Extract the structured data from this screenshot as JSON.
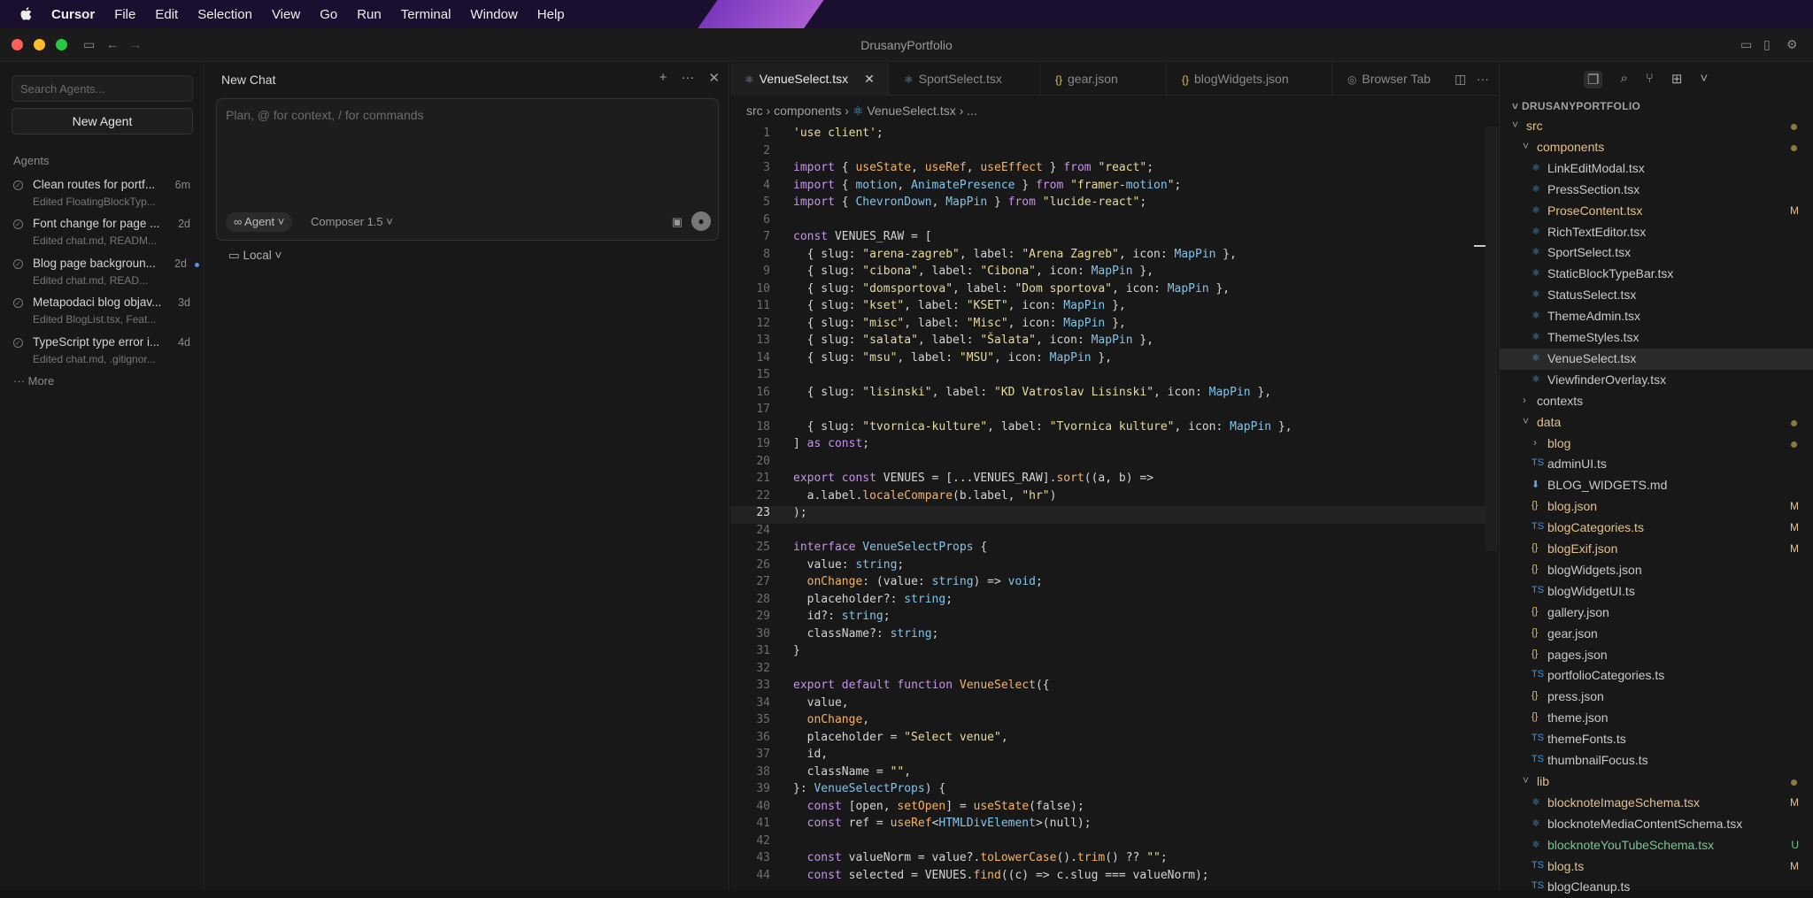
{
  "menubar": {
    "app": "Cursor",
    "items": [
      "File",
      "Edit",
      "Selection",
      "View",
      "Go",
      "Run",
      "Terminal",
      "Window",
      "Help"
    ]
  },
  "window": {
    "title": "DrusanyPortfolio"
  },
  "agents_panel": {
    "search_placeholder": "Search Agents...",
    "new_agent": "New Agent",
    "heading": "Agents",
    "items": [
      {
        "title": "Clean routes for portf...",
        "sub": "Edited FloatingBlockTyp...",
        "time": "6m",
        "unread": false
      },
      {
        "title": "Font change for page ...",
        "sub": "Edited chat.md, READM...",
        "time": "2d",
        "unread": false
      },
      {
        "title": "Blog page backgroun...",
        "sub": "Edited chat.md, READ...",
        "time": "2d",
        "unread": true
      },
      {
        "title": "Metapodaci blog objav...",
        "sub": "Edited BlogList.tsx, Feat...",
        "time": "3d",
        "unread": false
      },
      {
        "title": "TypeScript type error i...",
        "sub": "Edited chat.md, .gitignor...",
        "time": "4d",
        "unread": false
      }
    ],
    "more": "More"
  },
  "chat": {
    "title": "New Chat",
    "placeholder": "Plan, @ for context, / for commands",
    "mode": "Agent",
    "model": "Composer 1.5",
    "location": "Local"
  },
  "editor": {
    "tabs": [
      {
        "label": "VenueSelect.tsx",
        "icon": "react",
        "active": true
      },
      {
        "label": "SportSelect.tsx",
        "icon": "react",
        "active": false
      },
      {
        "label": "gear.json",
        "icon": "json",
        "active": false
      },
      {
        "label": "blogWidgets.json",
        "icon": "json",
        "active": false
      },
      {
        "label": "Browser Tab",
        "icon": "globe",
        "active": false
      }
    ],
    "breadcrumb": [
      "src",
      "components",
      "VenueSelect.tsx",
      "..."
    ],
    "current_line": 23,
    "lines": [
      "'use client';",
      "",
      "import { useState, useRef, useEffect } from \"react\";",
      "import { motion, AnimatePresence } from \"framer-motion\";",
      "import { ChevronDown, MapPin } from \"lucide-react\";",
      "",
      "const VENUES_RAW = [",
      "  { slug: \"arena-zagreb\", label: \"Arena Zagreb\", icon: MapPin },",
      "  { slug: \"cibona\", label: \"Cibona\", icon: MapPin },",
      "  { slug: \"domsportova\", label: \"Dom sportova\", icon: MapPin },",
      "  { slug: \"kset\", label: \"KSET\", icon: MapPin },",
      "  { slug: \"misc\", label: \"Misc\", icon: MapPin },",
      "  { slug: \"salata\", label: \"Šalata\", icon: MapPin },",
      "  { slug: \"msu\", label: \"MSU\", icon: MapPin },",
      "",
      "  { slug: \"lisinski\", label: \"KD Vatroslav Lisinski\", icon: MapPin },",
      "",
      "  { slug: \"tvornica-kulture\", label: \"Tvornica kulture\", icon: MapPin },",
      "] as const;",
      "",
      "export const VENUES = [...VENUES_RAW].sort((a, b) =>",
      "  a.label.localeCompare(b.label, \"hr\")",
      ");",
      "",
      "interface VenueSelectProps {",
      "  value: string;",
      "  onChange: (value: string) => void;",
      "  placeholder?: string;",
      "  id?: string;",
      "  className?: string;",
      "}",
      "",
      "export default function VenueSelect({",
      "  value,",
      "  onChange,",
      "  placeholder = \"Select venue\",",
      "  id,",
      "  className = \"\",",
      "}: VenueSelectProps) {",
      "  const [open, setOpen] = useState(false);",
      "  const ref = useRef<HTMLDivElement>(null);",
      "",
      "  const valueNorm = value?.toLowerCase().trim() ?? \"\";",
      "  const selected = VENUES.find((c) => c.slug === valueNorm);"
    ]
  },
  "explorer": {
    "root": "DRUSANYPORTFOLIO",
    "rows": [
      {
        "label": "src",
        "type": "folder-open",
        "depth": 0,
        "color": "mod",
        "dot": true
      },
      {
        "label": "components",
        "type": "folder-open",
        "depth": 1,
        "color": "mod",
        "dot": true
      },
      {
        "label": "LinkEditModal.tsx",
        "type": "react",
        "depth": 2
      },
      {
        "label": "PressSection.tsx",
        "type": "react",
        "depth": 2
      },
      {
        "label": "ProseContent.tsx",
        "type": "react",
        "depth": 2,
        "color": "mod",
        "badge": "M"
      },
      {
        "label": "RichTextEditor.tsx",
        "type": "react",
        "depth": 2
      },
      {
        "label": "SportSelect.tsx",
        "type": "react",
        "depth": 2
      },
      {
        "label": "StaticBlockTypeBar.tsx",
        "type": "react",
        "depth": 2
      },
      {
        "label": "StatusSelect.tsx",
        "type": "react",
        "depth": 2
      },
      {
        "label": "ThemeAdmin.tsx",
        "type": "react",
        "depth": 2
      },
      {
        "label": "ThemeStyles.tsx",
        "type": "react",
        "depth": 2
      },
      {
        "label": "VenueSelect.tsx",
        "type": "react",
        "depth": 2,
        "selected": true
      },
      {
        "label": "ViewfinderOverlay.tsx",
        "type": "react",
        "depth": 2
      },
      {
        "label": "contexts",
        "type": "folder-closed",
        "depth": 1
      },
      {
        "label": "data",
        "type": "folder-open",
        "depth": 1,
        "color": "mod",
        "dot": true
      },
      {
        "label": "blog",
        "type": "folder-closed",
        "depth": 2,
        "color": "mod",
        "dot": true
      },
      {
        "label": "adminUI.ts",
        "type": "ts",
        "depth": 2
      },
      {
        "label": "BLOG_WIDGETS.md",
        "type": "md",
        "depth": 2
      },
      {
        "label": "blog.json",
        "type": "json",
        "depth": 2,
        "color": "mod",
        "badge": "M"
      },
      {
        "label": "blogCategories.ts",
        "type": "ts",
        "depth": 2,
        "color": "mod",
        "badge": "M"
      },
      {
        "label": "blogExif.json",
        "type": "json",
        "depth": 2,
        "color": "mod",
        "badge": "M"
      },
      {
        "label": "blogWidgets.json",
        "type": "json",
        "depth": 2
      },
      {
        "label": "blogWidgetUI.ts",
        "type": "ts",
        "depth": 2
      },
      {
        "label": "gallery.json",
        "type": "json",
        "depth": 2
      },
      {
        "label": "gear.json",
        "type": "json",
        "depth": 2
      },
      {
        "label": "pages.json",
        "type": "json",
        "depth": 2
      },
      {
        "label": "portfolioCategories.ts",
        "type": "ts",
        "depth": 2
      },
      {
        "label": "press.json",
        "type": "json",
        "depth": 2
      },
      {
        "label": "theme.json",
        "type": "json",
        "depth": 2
      },
      {
        "label": "themeFonts.ts",
        "type": "ts",
        "depth": 2
      },
      {
        "label": "thumbnailFocus.ts",
        "type": "ts",
        "depth": 2
      },
      {
        "label": "lib",
        "type": "folder-open",
        "depth": 1,
        "color": "mod",
        "dot": true
      },
      {
        "label": "blocknoteImageSchema.tsx",
        "type": "react",
        "depth": 2,
        "color": "mod",
        "badge": "M"
      },
      {
        "label": "blocknoteMediaContentSchema.tsx",
        "type": "react",
        "depth": 2
      },
      {
        "label": "blocknoteYouTubeSchema.tsx",
        "type": "react",
        "depth": 2,
        "color": "untr",
        "badge": "U"
      },
      {
        "label": "blog.ts",
        "type": "ts",
        "depth": 2,
        "color": "mod",
        "badge": "M"
      },
      {
        "label": "blogCleanup.ts",
        "type": "ts",
        "depth": 2
      }
    ]
  }
}
